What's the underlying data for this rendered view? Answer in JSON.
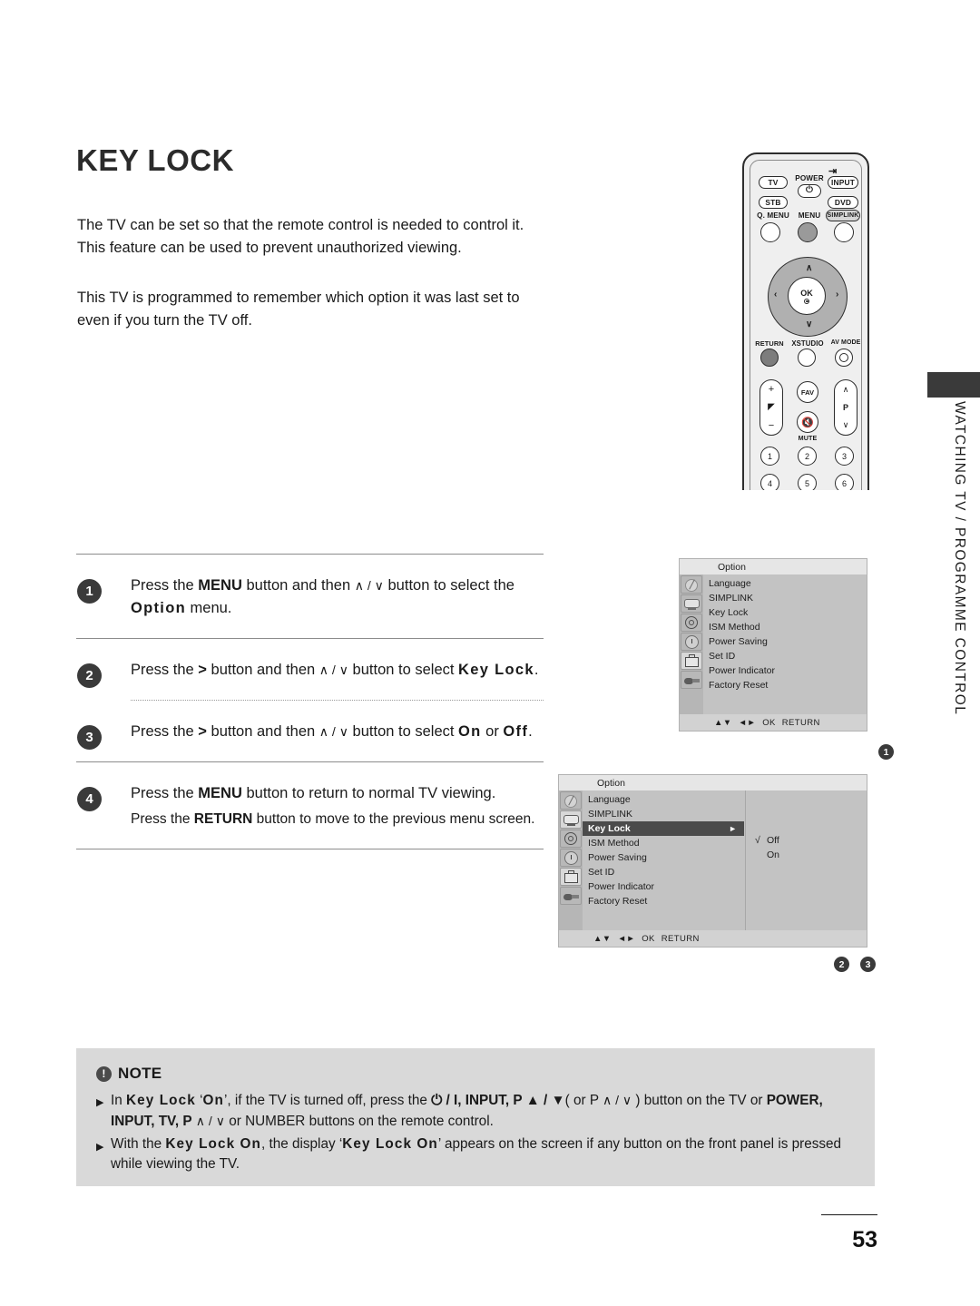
{
  "page": {
    "title": "KEY LOCK",
    "number": "53",
    "side_label": "WATCHING TV / PROGRAMME CONTROL"
  },
  "intro": {
    "p1": "The TV can be set so that the remote control is needed to control it.",
    "p2": "This feature can be used to prevent unauthorized viewing.",
    "p3": "This TV is programmed to remember which option it was last set to even if you turn the TV off."
  },
  "steps": [
    {
      "number": "1",
      "pre": "Press the ",
      "b1": "MENU",
      "mid": " button and then ",
      "glyph": "∧ / ∨",
      "mid2": " button to select the ",
      "b2": "Option",
      "post": " menu."
    },
    {
      "number": "2",
      "pre": "Press the ",
      "b1": ">",
      "mid": " button and then ",
      "glyph": "∧ / ∨",
      "mid2": " button to select ",
      "b2": "Key Lock",
      "post": "."
    },
    {
      "number": "3",
      "pre": "Press the ",
      "b1": ">",
      "mid": " button and then ",
      "glyph": "∧ / ∨",
      "mid2": " button to select ",
      "b2": "On",
      "mid3": " or ",
      "b3": "Off",
      "post": "."
    },
    {
      "number": "4",
      "line1_pre": "Press the ",
      "line1_b": "MENU",
      "line1_post": " button to return to normal TV viewing.",
      "line2_pre": "Press the ",
      "line2_b": "RETURN",
      "line2_post": " button to move to the previous menu screen."
    }
  ],
  "remote": {
    "tv": "TV",
    "power": "POWER",
    "input": "INPUT",
    "stb": "STB",
    "dvd": "DVD",
    "q_menu": "Q. MENU",
    "menu": "MENU",
    "simplink": "SIMPLINK",
    "ok": "OK",
    "return": "RETURN",
    "xstudio": "XSTUDIO",
    "av_mode": "AV MODE",
    "fav": "FAV",
    "mute": "MUTE",
    "prog": "P",
    "up_chev": "∧",
    "down_chev": "∨",
    "left_chev": "‹",
    "right_chev": "›",
    "plus": "+",
    "minus": "−",
    "numbers": [
      "1",
      "2",
      "3",
      "4",
      "5",
      "6"
    ]
  },
  "osd1": {
    "header": "Option",
    "items": [
      "Language",
      "SIMPLINK",
      "Key Lock",
      "ISM Method",
      "Power Saving",
      "Set ID",
      "Power Indicator",
      "Factory Reset"
    ],
    "footer": [
      "▲▼",
      "◄►",
      "OK",
      "RETURN"
    ],
    "marker": "1",
    "icons": [
      "dish-icon",
      "tv-screen-icon",
      "target-icon",
      "clock-icon",
      "toolbox-icon",
      "plug-icon"
    ]
  },
  "osd2": {
    "header": "Option",
    "items": [
      "Language",
      "SIMPLINK",
      "Key Lock",
      "ISM Method",
      "Power Saving",
      "Set ID",
      "Power Indicator",
      "Factory Reset"
    ],
    "active_item": "Key Lock",
    "active_arrow": "►",
    "submenu": [
      {
        "tick": "√",
        "label": "Off"
      },
      {
        "tick": "",
        "label": "On"
      }
    ],
    "footer": [
      "▲▼",
      "◄►",
      "OK",
      "RETURN"
    ],
    "markers": [
      "2",
      "3"
    ]
  },
  "note": {
    "title": "NOTE",
    "bullet1": {
      "t1": "In ",
      "b1": "Key Lock",
      "t2": " ‘",
      "b2": "On",
      "t3": "’, if the TV is turned off, press the ",
      "b3": "⏻ / I, INPUT, P ▲ / ▼",
      "t4": "( or P ",
      "g1": "∧ / ∨",
      "t5": " ) button on the TV or ",
      "b4": "POWER, INPUT, TV, P",
      "g2": "∧ / ∨",
      "t6": " or NUMBER buttons on the remote control."
    },
    "bullet2": {
      "t1": "With the ",
      "b1": "Key Lock On",
      "t2": ", the display ‘",
      "b2": "Key Lock On",
      "t3": "’ appears on the screen if any button on the front panel is pressed while viewing the TV."
    }
  }
}
